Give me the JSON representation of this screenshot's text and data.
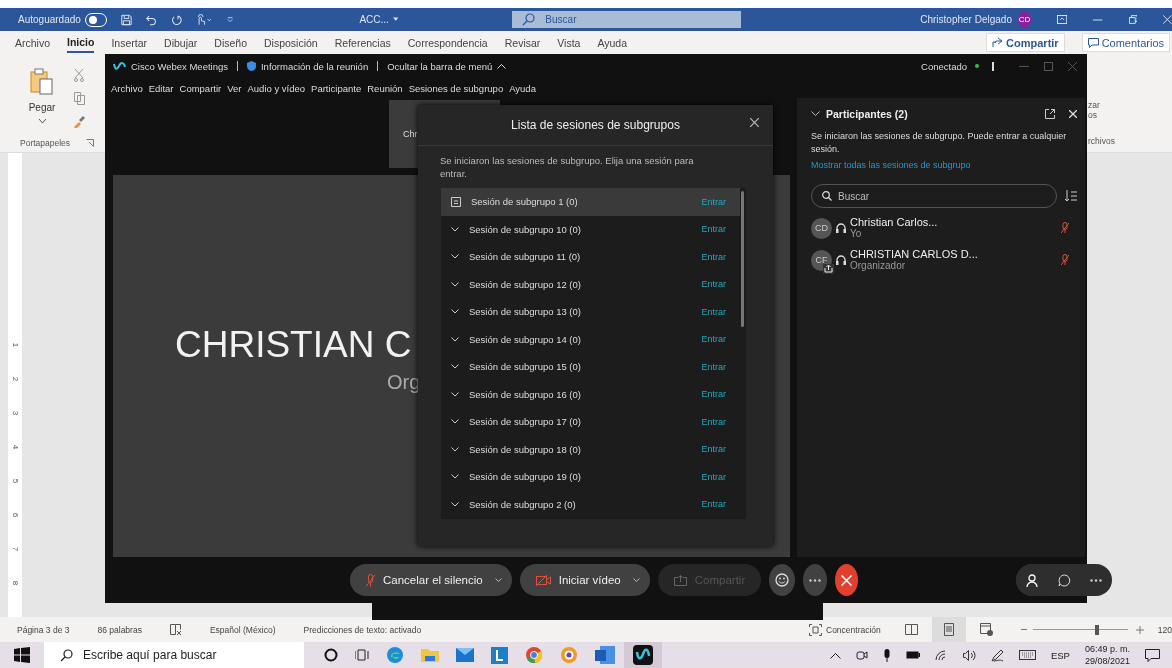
{
  "word": {
    "title_bar": {
      "autosave_label": "Autoguardado",
      "autosave_on": false,
      "doc_name": "ACC...",
      "search_placeholder": "Buscar",
      "user": "Christopher Delgado",
      "avatar": "CD"
    },
    "ribbon_tabs": [
      {
        "label": "Archivo",
        "selected": false
      },
      {
        "label": "Inicio",
        "selected": true
      },
      {
        "label": "Insertar",
        "selected": false
      },
      {
        "label": "Dibujar",
        "selected": false
      },
      {
        "label": "Diseño",
        "selected": false
      },
      {
        "label": "Disposición",
        "selected": false
      },
      {
        "label": "Referencias",
        "selected": false
      },
      {
        "label": "Correspondencia",
        "selected": false
      },
      {
        "label": "Revisar",
        "selected": false
      },
      {
        "label": "Vista",
        "selected": false
      },
      {
        "label": "Ayuda",
        "selected": false
      }
    ],
    "share_button": "Compartir",
    "comments_button": "Comentarios",
    "ribbon": {
      "paste": "Pegar",
      "group": "Portapapeles",
      "fragments": [
        "zar",
        "os"
      ],
      "group_right": "rchivos"
    },
    "ruler": [
      "1",
      "2",
      "3",
      "4",
      "5",
      "6",
      "7",
      "8"
    ],
    "status_bar": {
      "items": [
        "Página 3 de 3",
        "86 palabras",
        "Español (México)",
        "Predicciones de texto: activado"
      ],
      "focus": "Concentración",
      "zoom": {
        "level": 0.68
      },
      "zoom_text": "120"
    }
  },
  "webex": {
    "title": "Cisco Webex Meetings",
    "info": "Información de la reunión",
    "hide_menu": "Ocultar la barra de menú",
    "status": "Conectado",
    "menu": [
      "Archivo",
      "Editar",
      "Compartir",
      "Ver",
      "Audio y vídeo",
      "Participante",
      "Reunión",
      "Sesiones de subgrupo",
      "Ayuda"
    ],
    "thumbnail": "Chr",
    "stage": {
      "name": "CHRISTIAN C",
      "role": "Org"
    },
    "dialog": {
      "title": "Lista de sesiones de subgrupos",
      "message": "Se iniciaron las sesiones de subgrupo. Elija una sesión para entrar.",
      "sessions": [
        {
          "name": "Sesión de subgrupo 1 (0)",
          "selected": true,
          "action": "Entrar"
        },
        {
          "name": "Sesión de subgrupo 10 (0)",
          "selected": false,
          "action": "Entrar"
        },
        {
          "name": "Sesión de subgrupo 11 (0)",
          "selected": false,
          "action": "Entrar"
        },
        {
          "name": "Sesión de subgrupo 12 (0)",
          "selected": false,
          "action": "Entrar"
        },
        {
          "name": "Sesión de subgrupo 13 (0)",
          "selected": false,
          "action": "Entrar"
        },
        {
          "name": "Sesión de subgrupo 14 (0)",
          "selected": false,
          "action": "Entrar"
        },
        {
          "name": "Sesión de subgrupo 15 (0)",
          "selected": false,
          "action": "Entrar"
        },
        {
          "name": "Sesión de subgrupo 16 (0)",
          "selected": false,
          "action": "Entrar"
        },
        {
          "name": "Sesión de subgrupo 17 (0)",
          "selected": false,
          "action": "Entrar"
        },
        {
          "name": "Sesión de subgrupo 18 (0)",
          "selected": false,
          "action": "Entrar"
        },
        {
          "name": "Sesión de subgrupo 19 (0)",
          "selected": false,
          "action": "Entrar"
        },
        {
          "name": "Sesión de subgrupo 2 (0)",
          "selected": false,
          "action": "Entrar"
        }
      ]
    },
    "participants": {
      "title": "Participantes (2)",
      "notice": "Se iniciaron las sesiones de subgrupo. Puede entrar a cualquier sesión.",
      "link": "Mostrar todas las sesiones de subgrupo",
      "search_placeholder": "Buscar",
      "people": [
        {
          "initials": "CD",
          "name": "Christian Carlos...",
          "role": "Yo",
          "sharing": false
        },
        {
          "initials": "CF",
          "name": "CHRISTIAN CARLOS D...",
          "role": "Organizador",
          "sharing": true
        }
      ]
    },
    "controls": [
      {
        "kind": "mute",
        "label": "Cancelar el silencio",
        "disabled": false
      },
      {
        "kind": "video",
        "label": "Iniciar vídeo",
        "disabled": false
      },
      {
        "kind": "share",
        "label": "Compartir",
        "disabled": true
      }
    ]
  },
  "taskbar": {
    "search_placeholder": "Escribe aquí para buscar",
    "language": "ESP",
    "time": "06:49 p. m.",
    "date": "29/08/2021"
  }
}
